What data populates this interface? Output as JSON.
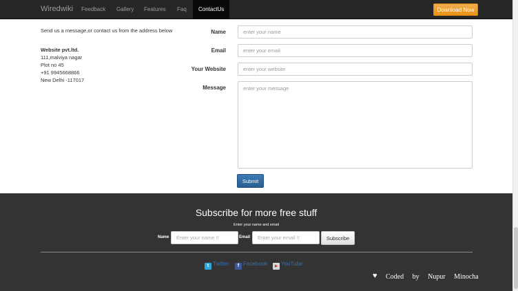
{
  "navbar": {
    "brand": "Wiredwiki",
    "items": [
      "Feedback",
      "Gallery",
      "Features",
      "Faq",
      "ContactUs"
    ],
    "active_item": "ContactUs",
    "download_label": "Download Now"
  },
  "contact": {
    "intro": "Send us a message,or contact us from the address below",
    "company": "Website pvt.ltd.",
    "address_lines": [
      "111,malviya nagar",
      "Plot no 45",
      "+91 9945668866",
      "New Delhi -117017"
    ]
  },
  "form": {
    "name_label": "Name",
    "name_placeholder": "enter your name",
    "email_label": "Email",
    "email_placeholder": "enter your email",
    "website_label": "Your Website",
    "website_placeholder": "enter your website",
    "message_label": "Message",
    "message_placeholder": "enter your message",
    "submit_label": "Submit"
  },
  "footer": {
    "subscribe_title": "Subscribe for more free stuff",
    "subscribe_hint": "Enter your name and email",
    "name_label": "Name",
    "name_placeholder": "Enter your name !!",
    "email_label": "Email",
    "email_placeholder": "Enter your email !!",
    "subscribe_button": "Subscribe",
    "social": [
      {
        "label": "Twitter",
        "icon": "twitter-icon"
      },
      {
        "label": "Facebook",
        "icon": "facebook-icon"
      },
      {
        "label": "YouTube",
        "icon": "youtube-icon"
      }
    ],
    "credit": "Coded by Nupur Minocha"
  },
  "colors": {
    "navbar_bg": "#262626",
    "download_button": "#f0ad4e",
    "submit_button": "#2a5f92",
    "footer_bg": "#333333",
    "link": "#3a6ea5"
  }
}
